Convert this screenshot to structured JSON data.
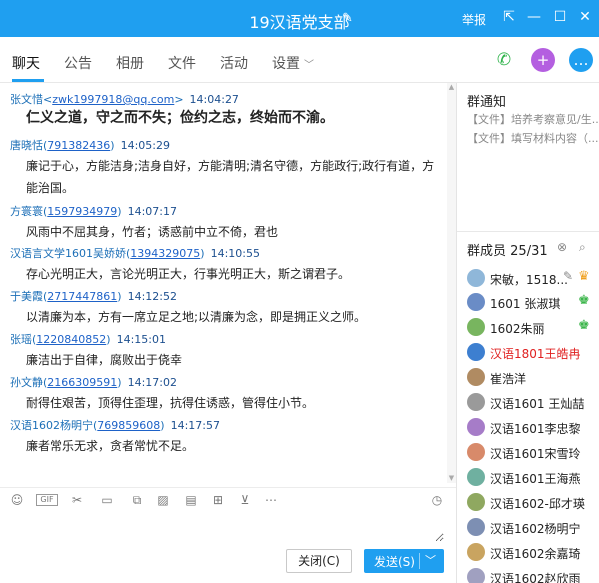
{
  "titlebar": {
    "title": "19汉语党支部",
    "report_label": "举报",
    "edit_icon": "edit-icon"
  },
  "tabs": [
    {
      "label": "聊天"
    },
    {
      "label": "公告"
    },
    {
      "label": "相册"
    },
    {
      "label": "文件"
    },
    {
      "label": "活动"
    },
    {
      "label": "设置"
    }
  ],
  "messages": [
    {
      "sender": "张文惜",
      "contact": "zwk1997918@qq.com",
      "time": "14:04:27",
      "text": "仁义之道，守之而不失；俭约之志，终始而不渝。",
      "bold": true
    },
    {
      "sender": "唐晓恬",
      "contact": "791382436",
      "time": "14:05:29",
      "text": "廉记于心，方能洁身;洁身自好，方能清明;清名守德，方能政行;政行有道，方能治国。"
    },
    {
      "sender": "方寰寰",
      "contact": "1597934979",
      "time": "14:07:17",
      "text": "风雨中不屈其身，竹者；诱惑前中立不倚，君也"
    },
    {
      "sender": "汉语言文学1601吴娇娇",
      "contact": "1394329075",
      "time": "14:10:55",
      "text": "存心光明正大，言论光明正大，行事光明正大，斯之谓君子。"
    },
    {
      "sender": "于美霞",
      "contact": "2717447861",
      "time": "14:12:52",
      "text": "以清廉为本，方有一席立足之地;以清廉为念，即是拥正义之师。"
    },
    {
      "sender": "张瑶",
      "contact": "1220840852",
      "time": "14:15:01",
      "text": "廉洁出于自律，腐败出于侥幸"
    },
    {
      "sender": "孙文静",
      "contact": "2166309591",
      "time": "14:17:02",
      "text": "耐得住艰苦，顶得住歪理，抗得住诱惑，管得住小节。"
    },
    {
      "sender": "汉语1602杨明宁",
      "contact": "769859608",
      "time": "14:17:57",
      "text": "廉者常乐无求，贪者常忧不足。"
    }
  ],
  "input": {
    "value": ""
  },
  "buttons": {
    "close": "关闭(C)",
    "send": "发送(S)"
  },
  "sidebar": {
    "notice_title": "群通知",
    "notices": [
      "【文件】培养考察意见/生...",
      "【文件】填写材料内容（..."
    ],
    "members_label": "群成员",
    "members_count": "25/31",
    "members": [
      {
        "name": "宋敏，1518...",
        "role": "owner"
      },
      {
        "name": "1601 张淑琪",
        "role": "admin"
      },
      {
        "name": "1602朱丽",
        "role": "admin"
      },
      {
        "name": "汉语1801王皓冉",
        "red": true
      },
      {
        "name": "崔浩洋"
      },
      {
        "name": "汉语1601 王灿喆"
      },
      {
        "name": "汉语1601李忠黎"
      },
      {
        "name": "汉语1601宋雪玲"
      },
      {
        "name": "汉语1601王海燕"
      },
      {
        "name": "汉语1602-邱才瑛"
      },
      {
        "name": "汉语1602杨明宁"
      },
      {
        "name": "汉语1602余嘉琦"
      },
      {
        "name": "汉语1602赵欣雨"
      }
    ]
  },
  "colors": {
    "accent": "#1f9ff0",
    "link": "#1e62c8",
    "admin": "#3bb54a",
    "highlight": "#e02020"
  }
}
